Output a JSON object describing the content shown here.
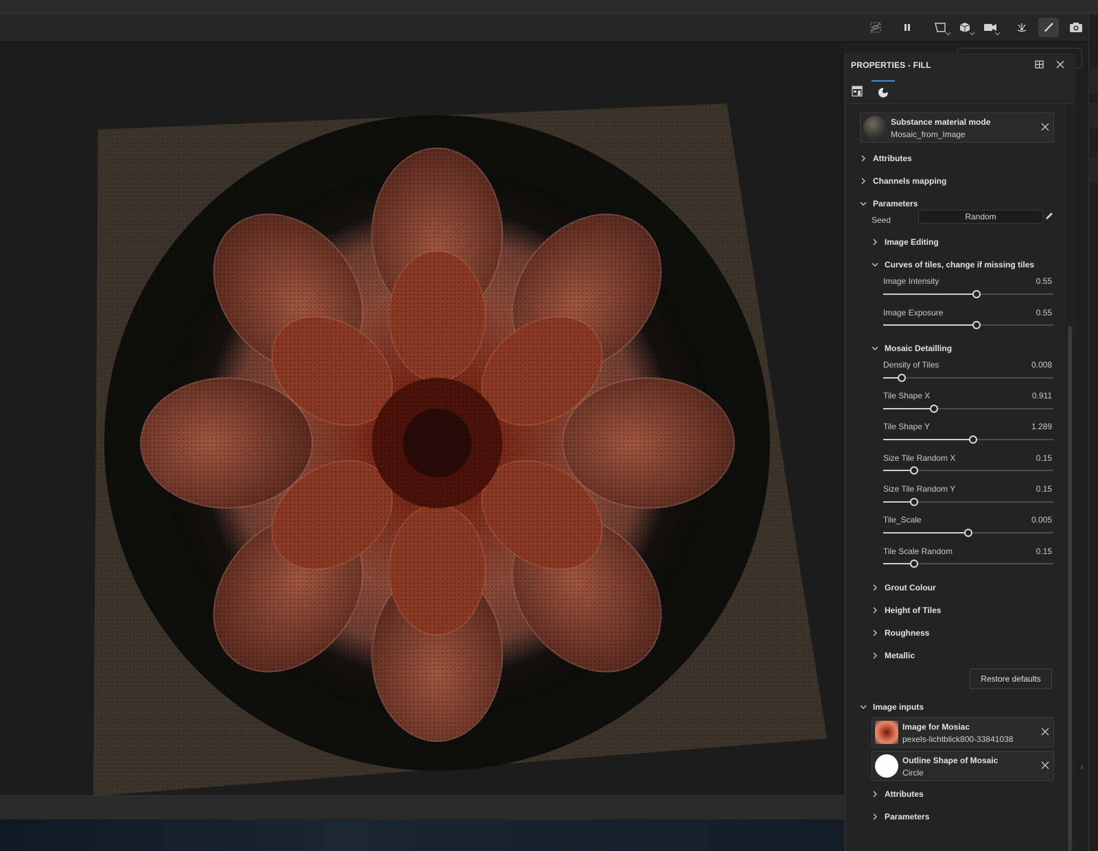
{
  "toolbar": {
    "icons": [
      "hide-icon",
      "pause-icon",
      "frame-icon",
      "cube-icon",
      "camera-icon",
      "lighting-icon",
      "brush-icon",
      "screenshot-icon"
    ],
    "active_icon": "brush-icon"
  },
  "panel": {
    "title": "PROPERTIES - FILL",
    "tabs": [
      "fill-settings-icon",
      "material-ball-icon"
    ],
    "material_card": {
      "title": "Substance material mode",
      "subtitle": "Mosaic_from_Image"
    },
    "sections": {
      "attributes": "Attributes",
      "channels_mapping": "Channels mapping",
      "parameters": "Parameters"
    },
    "seed": {
      "label": "Seed",
      "value": "Random"
    },
    "groups": {
      "image_editing": "Image Editing",
      "curves": "Curves of tiles, change if missing tiles",
      "mosaic_detailling": "Mosaic Detailling",
      "grout_colour": "Grout Colour",
      "height_of_tiles": "Height of Tiles",
      "roughness": "Roughness",
      "metallic": "Metallic"
    },
    "curves_params": [
      {
        "label": "Image Intensity",
        "value": "0.55",
        "fraction": 0.55
      },
      {
        "label": "Image Exposure",
        "value": "0.55",
        "fraction": 0.55
      }
    ],
    "mosaic_params": [
      {
        "label": "Density of Tiles",
        "value": "0.008",
        "fraction": 0.11
      },
      {
        "label": "Tile Shape X",
        "value": "0.911",
        "fraction": 0.3
      },
      {
        "label": "Tile Shape Y",
        "value": "1.289",
        "fraction": 0.53
      },
      {
        "label": "Size Tile Random X",
        "value": "0.15",
        "fraction": 0.18
      },
      {
        "label": "Size Tile Random Y",
        "value": "0.15",
        "fraction": 0.18
      },
      {
        "label": "Tile_Scale",
        "value": "0.005",
        "fraction": 0.5
      },
      {
        "label": "Tile Scale Random",
        "value": "0.15",
        "fraction": 0.18
      }
    ],
    "restore_defaults": "Restore defaults",
    "image_inputs": {
      "label": "Image inputs",
      "items": [
        {
          "title": "Image for Mosiac",
          "subtitle": "pexels-lichtblick800-33841038"
        },
        {
          "title": "Outline Shape of Mosaic",
          "subtitle": "Circle"
        }
      ],
      "attributes": "Attributes",
      "parameters": "Parameters"
    }
  },
  "colors": {
    "accent": "#3b8cd6",
    "panel_bg": "#232323",
    "viewport_bg": "#1c1c1c"
  }
}
